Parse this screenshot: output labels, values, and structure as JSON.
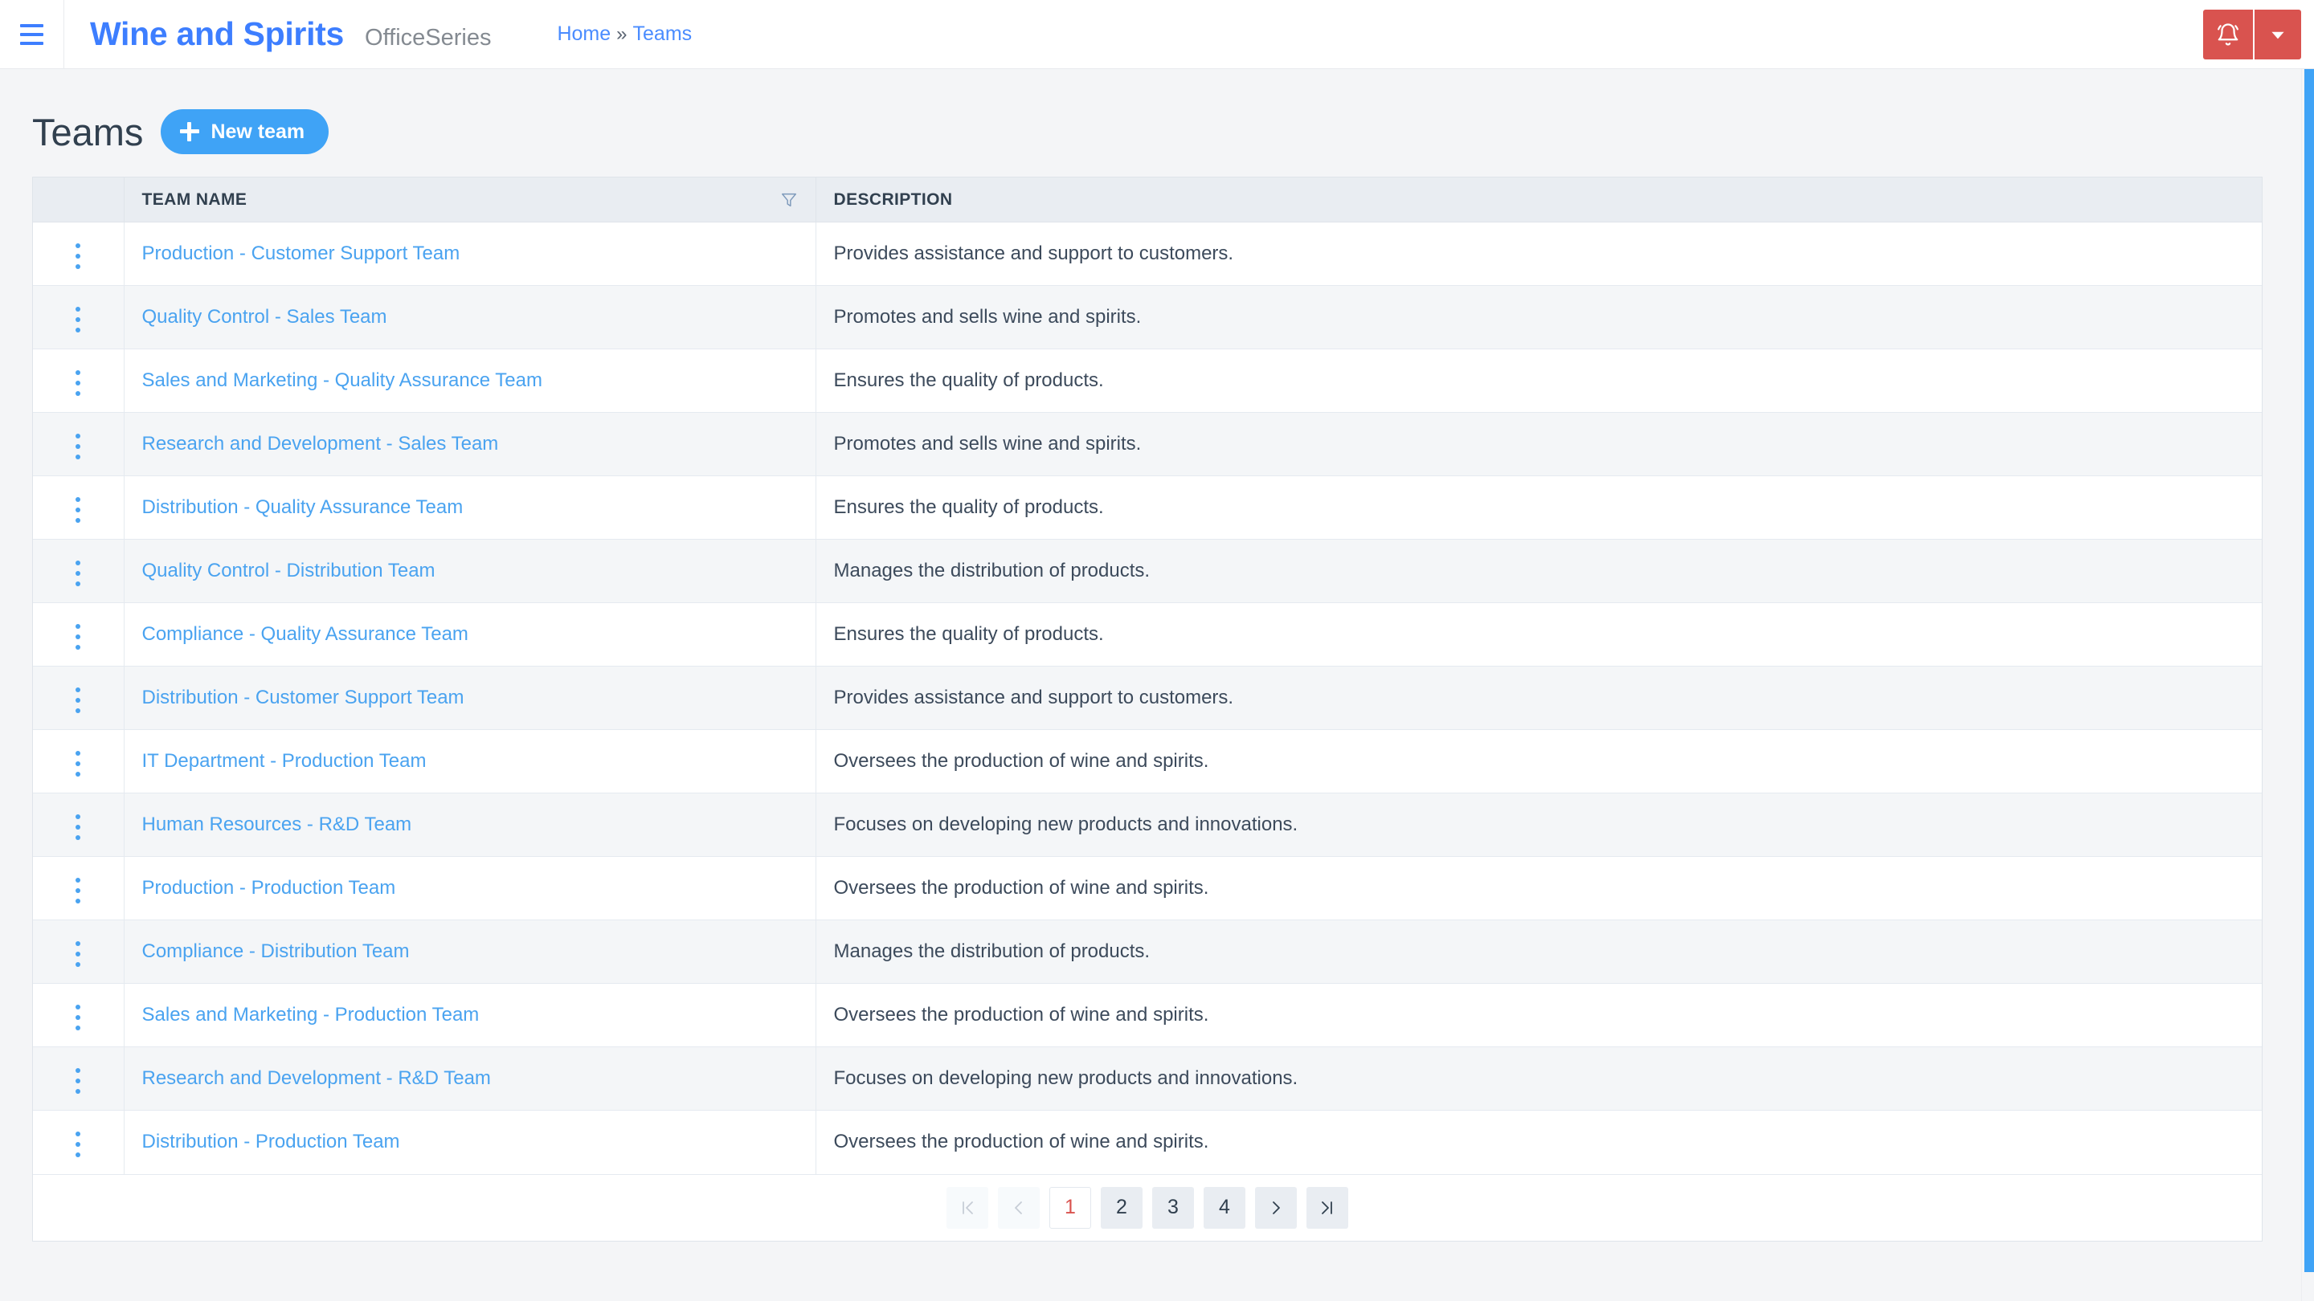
{
  "topbar": {
    "menu_icon": "hamburger-icon",
    "brand": "Wine and Spirits",
    "brand_suffix": "OfficeSeries",
    "breadcrumb": {
      "home": "Home",
      "separator": "»",
      "current": "Teams"
    },
    "alert_icon": "bell-icon",
    "caret_icon": "chevron-down-icon",
    "alert_color": "#d9534f"
  },
  "page": {
    "title": "Teams",
    "new_button_label": "New team",
    "new_button_icon": "plus-icon",
    "accent_color": "#3fa3f6",
    "link_color": "#4aa3f0"
  },
  "table": {
    "columns": [
      {
        "key": "menu",
        "label": ""
      },
      {
        "key": "name",
        "label": "TEAM NAME",
        "filter_icon": "filter-icon"
      },
      {
        "key": "description",
        "label": "DESCRIPTION"
      }
    ],
    "row_menu_icon": "kebab-menu-icon",
    "rows": [
      {
        "name": "Production - Customer Support Team",
        "description": "Provides assistance and support to customers."
      },
      {
        "name": "Quality Control - Sales Team",
        "description": "Promotes and sells wine and spirits."
      },
      {
        "name": "Sales and Marketing - Quality Assurance Team",
        "description": "Ensures the quality of products."
      },
      {
        "name": "Research and Development - Sales Team",
        "description": "Promotes and sells wine and spirits."
      },
      {
        "name": "Distribution - Quality Assurance Team",
        "description": "Ensures the quality of products."
      },
      {
        "name": "Quality Control - Distribution Team",
        "description": "Manages the distribution of products."
      },
      {
        "name": "Compliance - Quality Assurance Team",
        "description": "Ensures the quality of products."
      },
      {
        "name": "Distribution - Customer Support Team",
        "description": "Provides assistance and support to customers."
      },
      {
        "name": "IT Department - Production Team",
        "description": "Oversees the production of wine and spirits."
      },
      {
        "name": "Human Resources - R&D Team",
        "description": "Focuses on developing new products and innovations."
      },
      {
        "name": "Production - Production Team",
        "description": "Oversees the production of wine and spirits."
      },
      {
        "name": "Compliance - Distribution Team",
        "description": "Manages the distribution of products."
      },
      {
        "name": "Sales and Marketing - Production Team",
        "description": "Oversees the production of wine and spirits."
      },
      {
        "name": "Research and Development - R&D Team",
        "description": "Focuses on developing new products and innovations."
      },
      {
        "name": "Distribution - Production Team",
        "description": "Oversees the production of wine and spirits."
      }
    ]
  },
  "pagination": {
    "first_icon": "first-page-icon",
    "prev_icon": "previous-page-icon",
    "next_icon": "next-page-icon",
    "last_icon": "last-page-icon",
    "pages": [
      "1",
      "2",
      "3",
      "4"
    ],
    "current_page": "1",
    "current_color": "#d9534f"
  },
  "scrollbar": {
    "orientation": "vertical",
    "thumb_color": "#3fa3f6"
  }
}
